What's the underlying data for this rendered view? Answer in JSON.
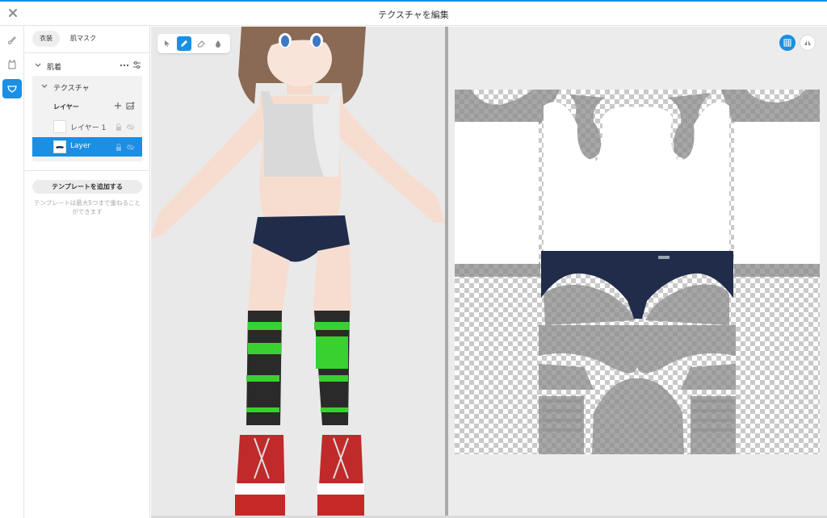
{
  "window": {
    "title": "テクスチャを編集",
    "accent": "#1a8fe3"
  },
  "toolrail": {
    "items": [
      "brush-icon",
      "clothing-icon",
      "texture-layers-icon"
    ],
    "active": "texture-layers-icon"
  },
  "panel": {
    "tabs": [
      {
        "label": "衣装",
        "active": true
      },
      {
        "label": "肌マスク",
        "active": false
      }
    ],
    "part": {
      "label": "肌着"
    },
    "texture": {
      "label": "テクスチャ"
    },
    "layers": {
      "header": "レイヤー",
      "items": [
        {
          "name": "レイヤー 1",
          "selected": false
        },
        {
          "name": "Layer",
          "selected": true
        }
      ]
    },
    "template": {
      "button": "テンプレートを追加する",
      "note": "テンプレートは最大5つまで重ねることができます"
    }
  },
  "viewport": {
    "tools": [
      "select-icon",
      "pencil-icon",
      "eraser-icon",
      "fill-icon"
    ],
    "active_tool": "pencil-icon"
  },
  "uv": {
    "buttons": [
      "grid-view-icon",
      "symmetry-icon"
    ],
    "garment_color": "#202c49",
    "silhouette_color": "#8e8e8e"
  }
}
